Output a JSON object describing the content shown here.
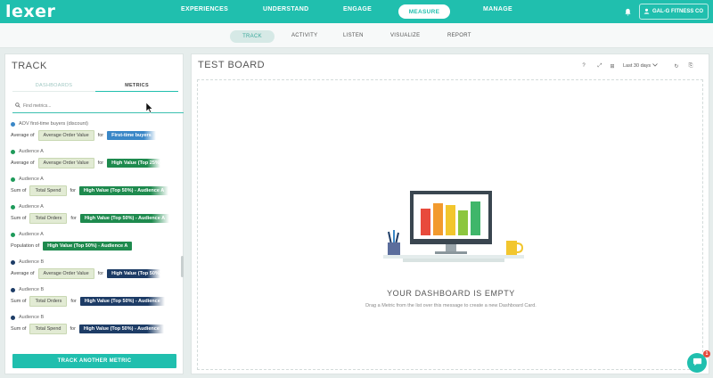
{
  "app": {
    "logo": "lexer"
  },
  "topnav": {
    "items": [
      "EXPERIENCES",
      "UNDERSTAND",
      "ENGAGE",
      "MEASURE",
      "MANAGE"
    ],
    "active": "MEASURE",
    "account": "GAL-G FITNESS CO",
    "icons": [
      "bell-icon",
      "user-icon"
    ]
  },
  "subnav": {
    "items": [
      "TRACK",
      "ACTIVITY",
      "LISTEN",
      "VISUALIZE",
      "REPORT"
    ],
    "active": "TRACK"
  },
  "track": {
    "title": "TRACK",
    "tabs": [
      "DASHBOARDS",
      "METRICS"
    ],
    "active_tab": "METRICS",
    "search_placeholder": "Find metrics...",
    "metrics": [
      {
        "name": "AOV first-time buyers (discount)",
        "dot": "#3a87c7",
        "agg_prefix": "Average of",
        "agg": "Average Order Value",
        "for": "for",
        "audience": "First-time buyers",
        "aud_color": "#3a87c7"
      },
      {
        "name": "Audience A",
        "dot": "#1e9a5a",
        "agg_prefix": "Average of",
        "agg": "Average Order Value",
        "for": "for",
        "audience": "High Value (Top 25%)",
        "aud_color": "#1e8a4e"
      },
      {
        "name": "Audience A",
        "dot": "#1e9a5a",
        "agg_prefix": "Sum of",
        "agg": "Total Spend",
        "for": "for",
        "audience": "High Value (Top 50%) - Audience A",
        "aud_color": "#1e8a4e"
      },
      {
        "name": "Audience A",
        "dot": "#1e9a5a",
        "agg_prefix": "Sum of",
        "agg": "Total Orders",
        "for": "for",
        "audience": "High Value (Top 50%) - Audience A",
        "aud_color": "#1e8a4e"
      },
      {
        "name": "Audience A",
        "dot": "#1e9a5a",
        "agg_prefix": "Population of",
        "agg": "",
        "for": "",
        "audience": "High Value (Top 50%) - Audience A",
        "aud_color": "#1e8a4e"
      },
      {
        "name": "Audience B",
        "dot": "#1d3c66",
        "agg_prefix": "Average of",
        "agg": "Average Order Value",
        "for": "for",
        "audience": "High Value (Top 50%)",
        "aud_color": "#1d3c66"
      },
      {
        "name": "Audience B",
        "dot": "#1d3c66",
        "agg_prefix": "Sum of",
        "agg": "Total Orders",
        "for": "for",
        "audience": "High Value (Top 50%) - Audience",
        "aud_color": "#1d3c66"
      },
      {
        "name": "Audience B",
        "dot": "#1d3c66",
        "agg_prefix": "Sum of",
        "agg": "Total Spend",
        "for": "for",
        "audience": "High Value (Top 50%) - Audience",
        "aud_color": "#1d3c66"
      }
    ],
    "track_button": "TRACK ANOTHER METRIC"
  },
  "board": {
    "title": "TEST BOARD",
    "date_range": "Last 30 days",
    "tools": [
      "help-icon",
      "expand-icon",
      "grid-icon",
      "refresh-icon",
      "export-icon"
    ],
    "tool_glyphs": [
      "?",
      "⤢",
      "⊞",
      "↻",
      "⎘"
    ],
    "empty_title": "YOUR DASHBOARD IS EMPTY",
    "empty_subtitle": "Drag a Metric from the list over this message to create a new Dashboard Card.",
    "illustration_bar_colors": [
      "#e84a3c",
      "#f29a2e",
      "#f2c62e",
      "#8cc63f",
      "#3fb66a"
    ]
  },
  "chat": {
    "badge": "1"
  },
  "colors": {
    "accent": "#20bfae"
  }
}
